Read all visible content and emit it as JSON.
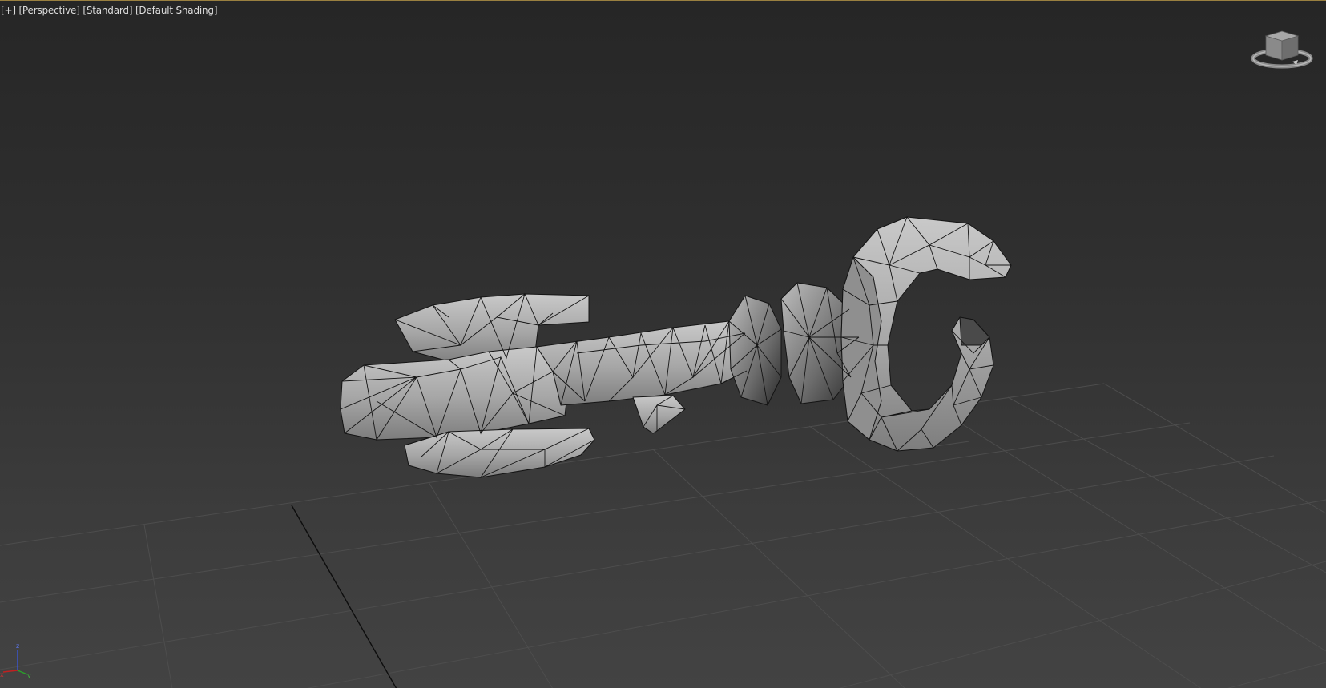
{
  "viewport": {
    "labels": {
      "plus": "[+]",
      "view": "[Perspective]",
      "style": "[Standard]",
      "shading": "[Default Shading]"
    },
    "viewcube_icon": "viewcube-icon",
    "tripod_icon": "axis-tripod-icon",
    "axes": {
      "z": "z",
      "x": "x",
      "y": "y"
    }
  },
  "colors": {
    "background_top": "#262626",
    "background_bottom": "#434343",
    "grid": "#4d4d4d",
    "mesh_fill": "#a9a9a9",
    "wire": "#141414",
    "active_border": "#9a8040",
    "axis_x": "#c02020",
    "axis_y": "#2aa22a",
    "axis_z": "#3a56d8"
  }
}
